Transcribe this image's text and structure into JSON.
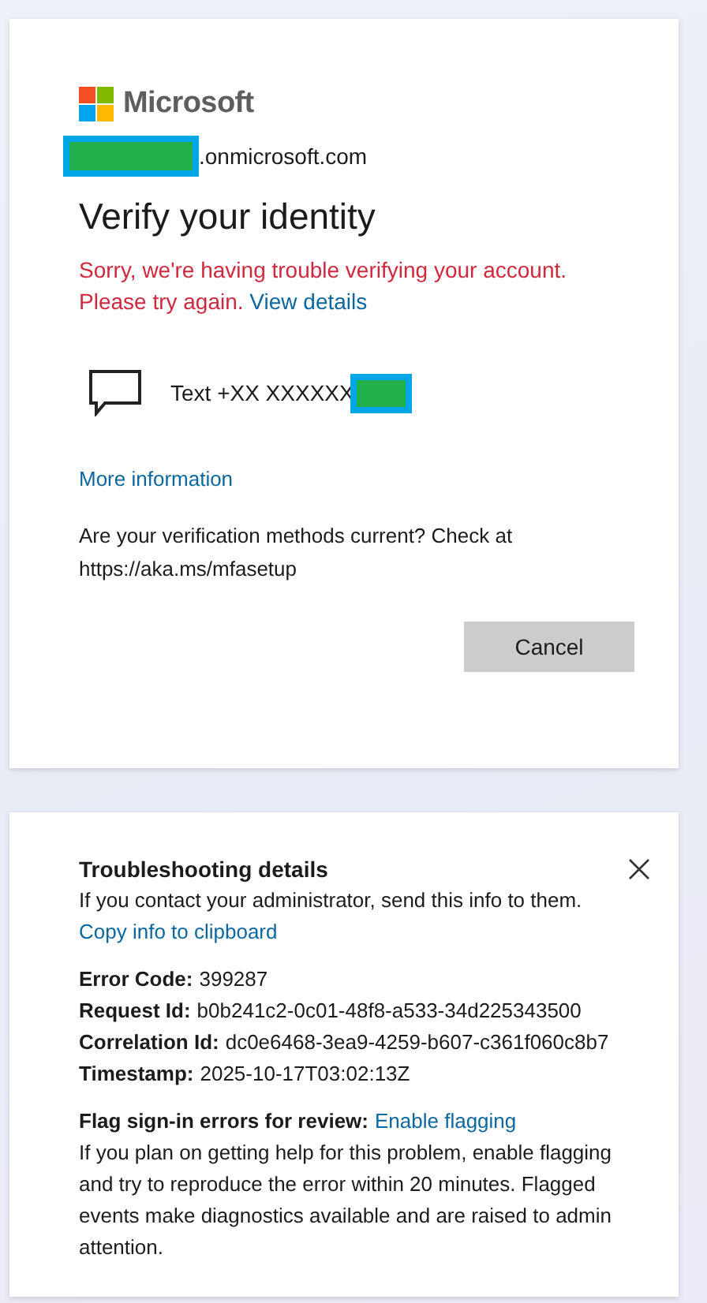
{
  "sign_in_card": {
    "brand": "Microsoft",
    "account": {
      "redacted": true,
      "suffix": ".onmicrosoft.com"
    },
    "title": "Verify your identity",
    "error": {
      "message": "Sorry, we're having trouble verifying your account. Please try again.",
      "link": "View details"
    },
    "methods": [
      {
        "kind": "sms",
        "label": "Text +XX XXXXXX",
        "redacted": true
      }
    ],
    "more_info_link": "More information",
    "note": "Are your verification methods current? Check at https://aka.ms/mfasetup",
    "buttons": [
      "Cancel"
    ]
  },
  "troubleshooting": {
    "title": "Troubleshooting details",
    "intro": "If you contact your administrator, send this info to them.",
    "copy_link": "Copy info to clipboard",
    "fields": [
      {
        "label": "Error Code:",
        "value": "399287"
      },
      {
        "label": "Request Id:",
        "value": "b0b241c2-0c01-48f8-a533-34d225343500"
      },
      {
        "label": "Correlation Id:",
        "value": "dc0e6468-3ea9-4259-b607-c361f060c8b7"
      },
      {
        "label": "Timestamp:",
        "value": "2025-10-17T03:02:13Z"
      }
    ],
    "flag": {
      "label": "Flag sign-in errors for review:",
      "link": "Enable flagging",
      "text": "If you plan on getting help for this problem, enable flagging and try to reproduce the error within 20 minutes. Flagged events make diagnostics available and are raised to admin attention."
    }
  }
}
